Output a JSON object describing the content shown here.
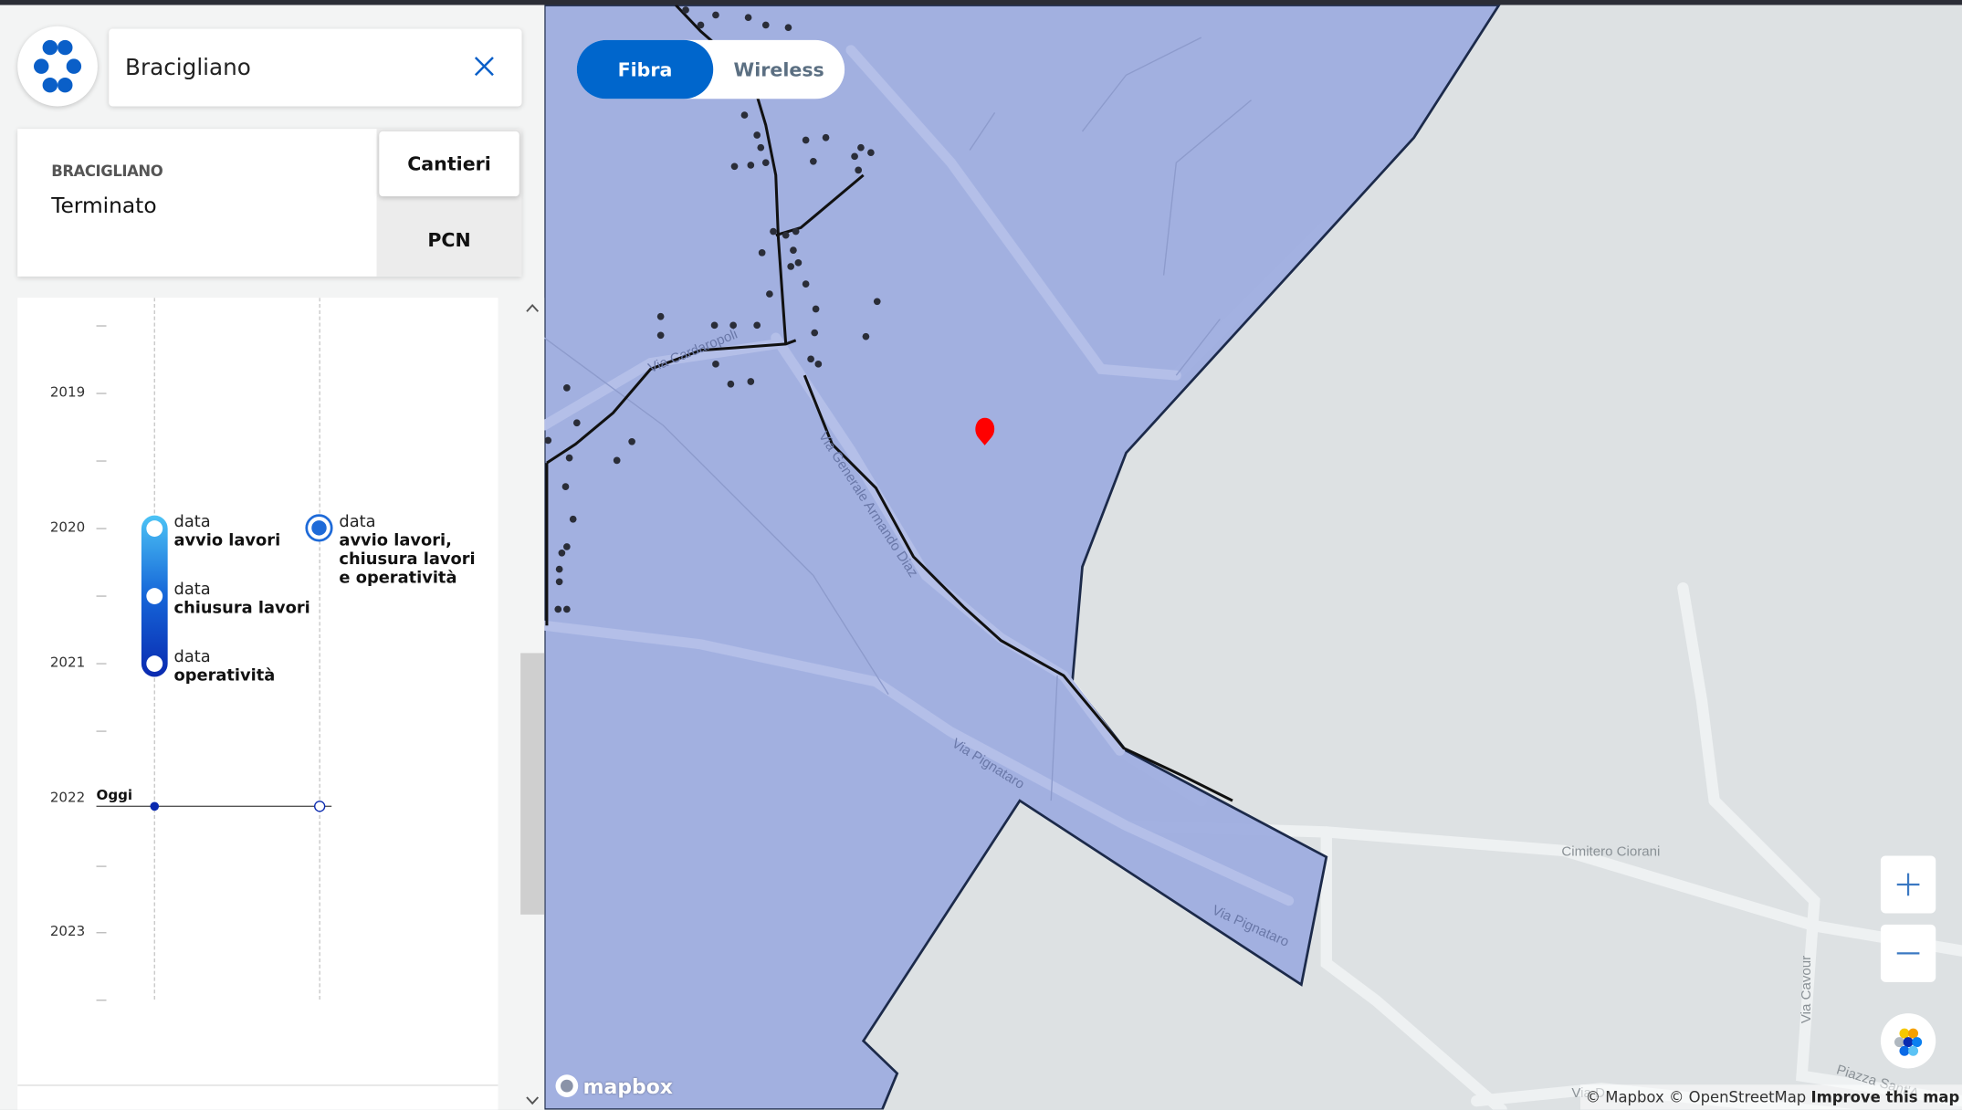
{
  "search": {
    "value": "Bracigliano",
    "clear_icon": "close-icon"
  },
  "card": {
    "comune": "BRACIGLIANO",
    "stato": "Terminato",
    "tabs": [
      "Cantieri",
      "PCN"
    ]
  },
  "timeline": {
    "years": [
      "2019",
      "2020",
      "2021",
      "2022",
      "2023"
    ],
    "today_label": "Oggi",
    "track1": [
      {
        "pre": "data",
        "label": "avvio lavori"
      },
      {
        "pre": "data",
        "label": "chiusura lavori"
      },
      {
        "pre": "data",
        "label": "operatività"
      }
    ],
    "track2": {
      "pre": "data",
      "lines": [
        "avvio lavori,",
        "chiusura lavori",
        "e operatività"
      ]
    }
  },
  "network_toggle": {
    "options": [
      "Fibra",
      "Wireless"
    ],
    "selected": "Fibra"
  },
  "map": {
    "street_labels": [
      "Via Cardaropoli",
      "Via Generale Armando Diaz",
      "Via Pignataro",
      "Via Pignataro",
      "Cimitero Ciorani",
      "Via Cavour",
      "Piazza Sant'A",
      "Via D"
    ],
    "attribution": {
      "mapbox": "© Mapbox",
      "osm": "© OpenStreetMap",
      "improve": "Improve this map"
    },
    "logo_text": "mapbox",
    "colors": {
      "coverage": "#a0aee0",
      "border": "#1c2a4a",
      "marker": "#ff0000",
      "accent": "#0066cc"
    }
  }
}
